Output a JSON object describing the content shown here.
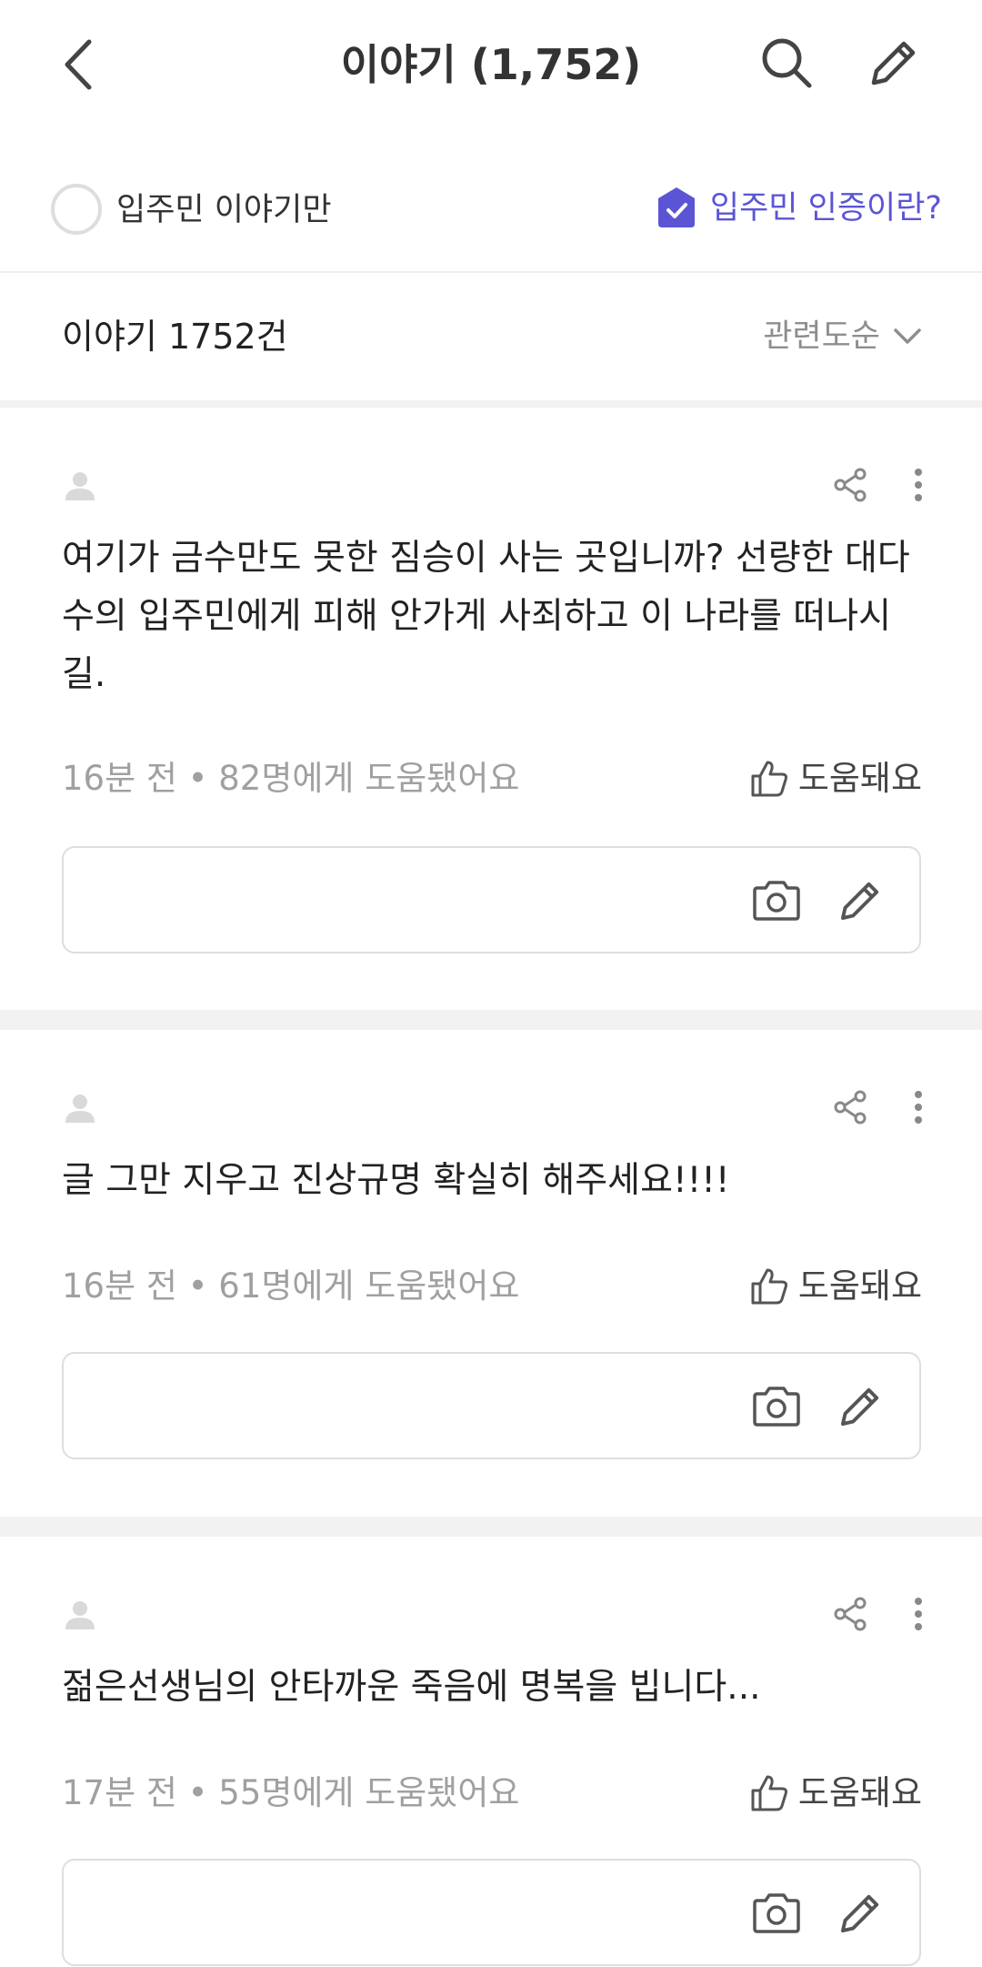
{
  "header": {
    "title": "이야기 (1,752)",
    "back_icon": "chevron-left-icon",
    "search_icon": "search-icon",
    "write_icon": "pencil-icon"
  },
  "filter": {
    "residents_only_label": "입주민 이야기만",
    "residents_only_checked": false,
    "verification_link_label": "입주민 인증이란?",
    "verification_icon": "shield-check-icon"
  },
  "list": {
    "count_label": "이야기 1752건",
    "sort_label": "관련도순"
  },
  "posts": [
    {
      "body": "여기가 금수만도 못한 짐승이 사는 곳입니까? 선량한 대다수의 입주민에게 피해 안가게 사죄하고 이 나라를 떠나시길.",
      "meta": "16분 전 • 82명에게 도움됐어요",
      "helpful_label": "도움돼요"
    },
    {
      "body": "글 그만 지우고 진상규명 확실히 해주세요!!!!",
      "meta": "16분 전 • 61명에게 도움됐어요",
      "helpful_label": "도움돼요"
    },
    {
      "body": "젊은선생님의 안타까운 죽음에 명복을 빕니다...",
      "meta": "17분 전 • 55명에게 도움됐어요",
      "helpful_label": "도움돼요"
    }
  ],
  "colors": {
    "accent": "#5b55d6",
    "text": "#222222",
    "muted": "#a0a0a0",
    "divider": "#f2f2f2",
    "icon": "#444444"
  }
}
